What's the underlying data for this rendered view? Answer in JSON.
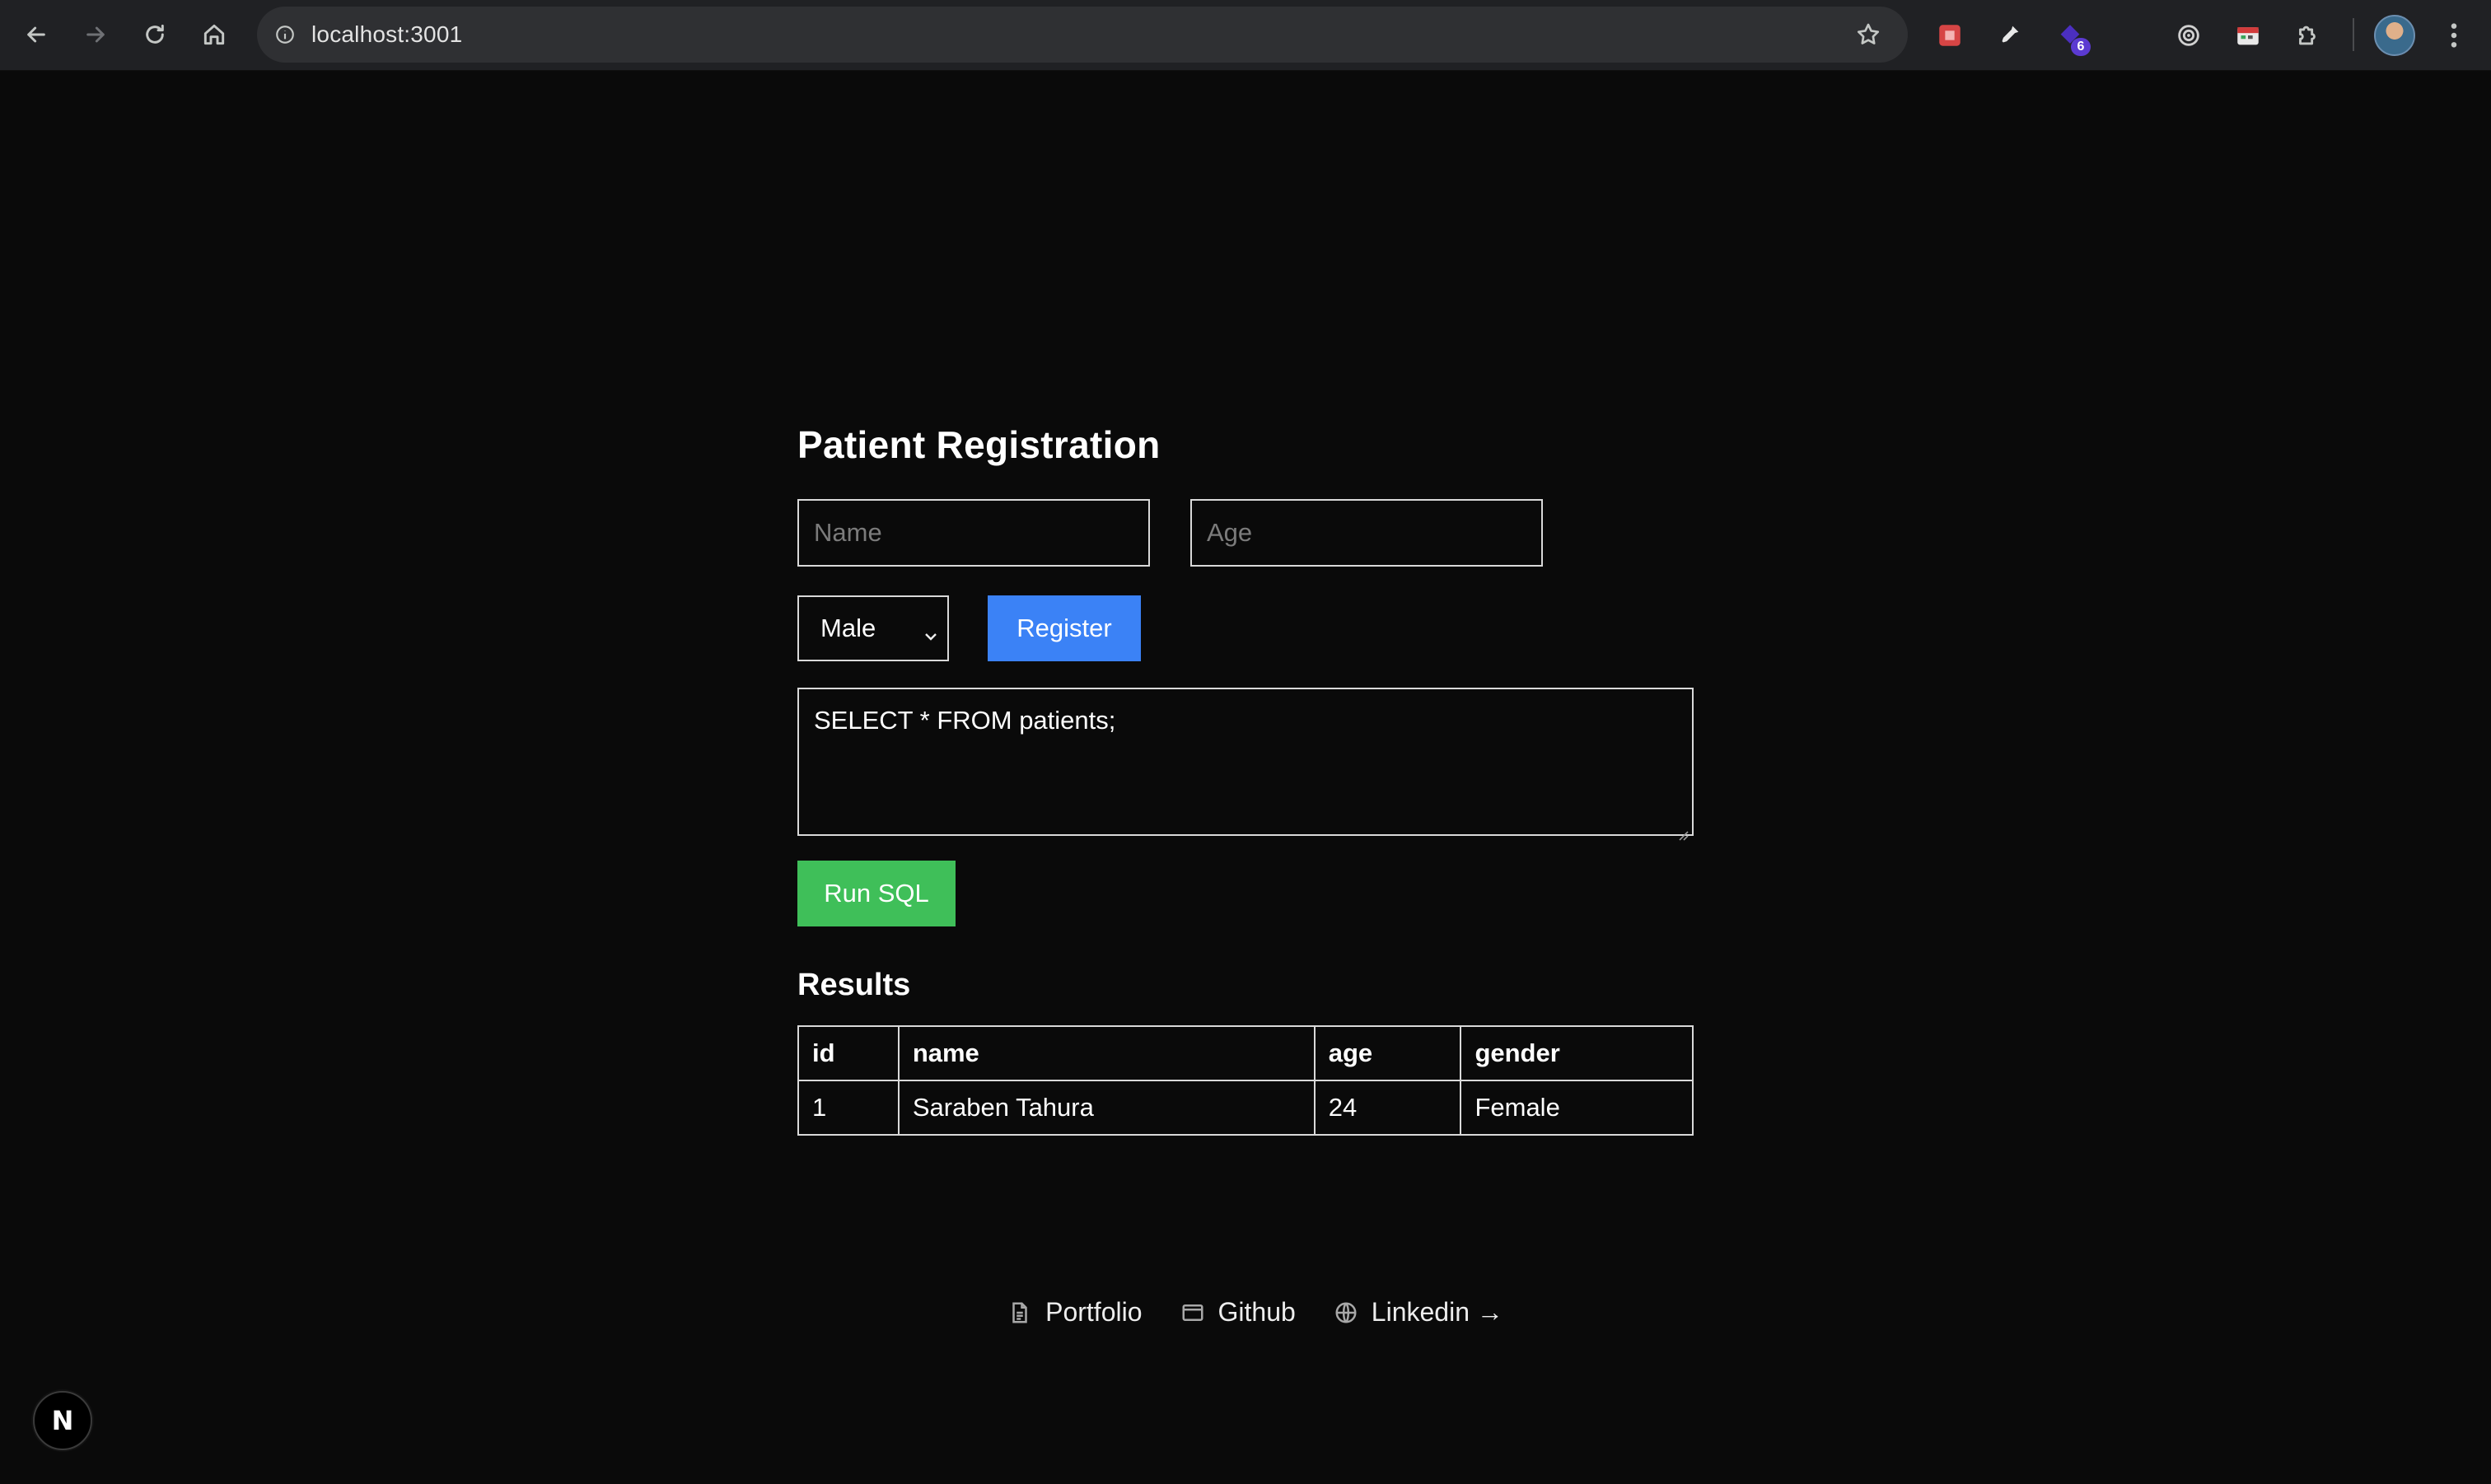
{
  "browser": {
    "url": "localhost:3001",
    "extension_badge_count": "6"
  },
  "form": {
    "title": "Patient Registration",
    "name_placeholder": "Name",
    "age_placeholder": "Age",
    "gender_selected": "Male",
    "register_label": "Register"
  },
  "sql": {
    "query": "SELECT * FROM patients;",
    "run_label": "Run SQL"
  },
  "results": {
    "title": "Results",
    "columns": [
      "id",
      "name",
      "age",
      "gender"
    ],
    "rows": [
      [
        "1",
        "Saraben Tahura",
        "24",
        "Female"
      ]
    ]
  },
  "footer": {
    "links": [
      {
        "label": "Portfolio",
        "icon": "file-icon"
      },
      {
        "label": "Github",
        "icon": "window-icon"
      },
      {
        "label": "Linkedin →",
        "icon": "globe-icon"
      }
    ]
  },
  "dev_badge": {
    "label": "N"
  },
  "colors": {
    "background": "#0a0a0a",
    "register_button": "#3b82f6",
    "run_button": "#3fbf59"
  }
}
